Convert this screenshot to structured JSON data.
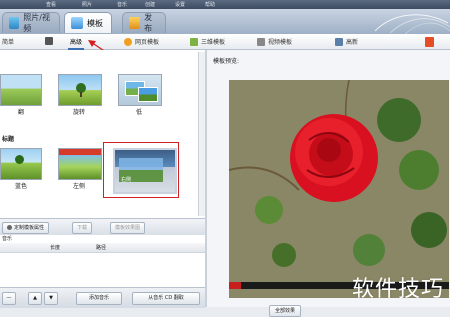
{
  "menubar": {
    "items": [
      "查看",
      "照片",
      "音乐",
      "创建",
      "设置",
      "帮助"
    ]
  },
  "tabs": [
    {
      "label": "照片/视频",
      "active": false,
      "icon": "photo-video-icon"
    },
    {
      "label": "模板",
      "active": true,
      "icon": "template-icon"
    },
    {
      "label": "发布",
      "active": false,
      "icon": "publish-icon"
    }
  ],
  "subtabs": [
    {
      "label": "简单",
      "icon": "simple-icon"
    },
    {
      "label": "高级",
      "icon": "advanced-icon",
      "active": true
    },
    {
      "label": "网页模板",
      "icon": "web-template-icon"
    },
    {
      "label": "三维模板",
      "icon": "3d-template-icon"
    },
    {
      "label": "视频模板",
      "icon": "video-template-icon"
    },
    {
      "label": "高新",
      "icon": "hi-tech-icon"
    }
  ],
  "gallery": {
    "row1_labels": [
      "翻",
      "旋转",
      "低"
    ],
    "section_label": "标题",
    "row2_labels": [
      "蓝色",
      "左侧",
      "右侧"
    ],
    "selected_caption": "右侧"
  },
  "actions": {
    "custom": "定制模板属性",
    "down": "下载",
    "more": "模板效果图"
  },
  "music": {
    "title": "音乐",
    "columns": [
      "",
      "长度",
      "路径"
    ]
  },
  "bottom": {
    "add_music": "添加音乐",
    "from_file": "从音乐 CD 翻取"
  },
  "preview": {
    "title": "模板预览:",
    "fullscreen": "全部效果"
  },
  "watermark": "软件技巧",
  "colors": {
    "accent": "#3d6fb5",
    "highlight": "#d32020",
    "menubar": "#3d4b60"
  }
}
